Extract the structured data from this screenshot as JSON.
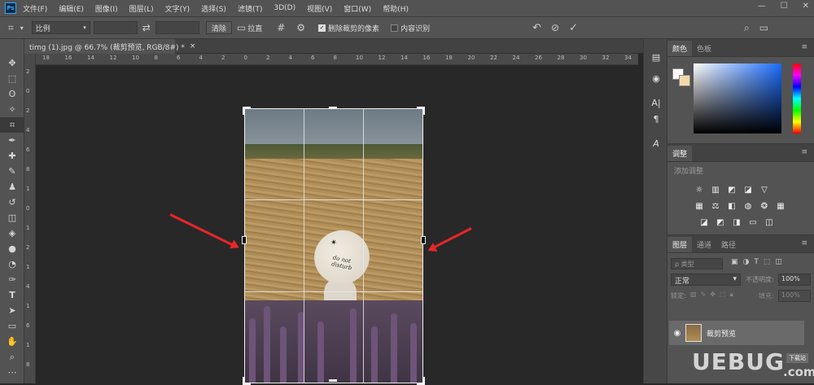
{
  "menubar": {
    "logo": "Ps",
    "items": [
      "文件(F)",
      "编辑(E)",
      "图像(I)",
      "图层(L)",
      "文字(Y)",
      "选择(S)",
      "滤镜(T)",
      "3D(D)",
      "视图(V)",
      "窗口(W)",
      "帮助(H)"
    ],
    "window_controls": [
      "—",
      "☐",
      "✕"
    ]
  },
  "options_bar": {
    "ratio_select": "比例",
    "clear_label": "清除",
    "straighten_label": "拉直",
    "delete_cropped_label": "删除裁剪的像素",
    "delete_cropped_checked": true,
    "content_aware_label": "内容识别",
    "content_aware_checked": false
  },
  "document_tab": {
    "title": "timg (1).jpg @ 66.7% (裁剪预览, RGB/8#) *",
    "close": "×"
  },
  "ruler": {
    "h_labels": [
      "18",
      "16",
      "14",
      "12",
      "10",
      "8",
      "6",
      "4",
      "2",
      "0",
      "2",
      "4",
      "6",
      "8",
      "10",
      "12",
      "14",
      "16",
      "18",
      "20",
      "22",
      "24",
      "26",
      "28",
      "30",
      "32",
      "34"
    ],
    "v_labels": [
      "2",
      "0",
      "2",
      "4",
      "6",
      "8",
      "1",
      "0",
      "1",
      "2",
      "1",
      "4",
      "1",
      "6",
      "1",
      "8"
    ]
  },
  "image": {
    "hat_text": "do not disturb"
  },
  "color_panel": {
    "tabs": [
      "颜色",
      "色板"
    ],
    "menu": "≡"
  },
  "adjust_panel": {
    "tab": "调整",
    "hint": "添加调整"
  },
  "layers_panel": {
    "tabs": [
      "图层",
      "通道",
      "路径"
    ],
    "filter_label": "ρ 类型",
    "blend_mode": "正常",
    "opacity_label": "不透明度:",
    "opacity_value": "100%",
    "lock_label": "锁定:",
    "fill_label": "填充:",
    "fill_value": "100%",
    "layer_name": "裁剪预览"
  },
  "watermark": {
    "logo": "UEBUG",
    "badge": "下载站",
    "suffix": ".com"
  },
  "colors": {
    "accent": "#31a8ff",
    "arrow": "#e8262a"
  }
}
